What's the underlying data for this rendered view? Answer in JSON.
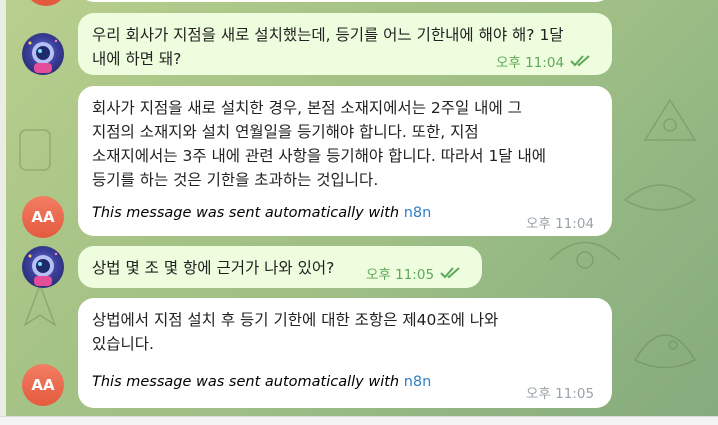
{
  "colors": {
    "outgoing_bubble": "#eefdde",
    "incoming_bubble": "#ffffff",
    "read_check": "#5ea85a",
    "link": "#2f7fc7",
    "avatar_aa": "#e55a3f"
  },
  "messages": [
    {
      "direction": "outgoing",
      "avatar": "bot-avatar",
      "lines": [
        "우리 회사가 지점을 새로 설치했는데, 등기를 어느 기한내에 해야 해? 1달",
        "내에 하면 돼?"
      ],
      "time": "오후 11:04",
      "status_icon": "double-check-icon"
    },
    {
      "direction": "incoming",
      "avatar_initials": "AA",
      "lines": [
        "회사가 지점을 새로 설치한 경우, 본점 소재지에서는 2주일 내에 그",
        "지점의 소재지와 설치 연월일을 등기해야 합니다. 또한, 지점",
        "소재지에서는 3주 내에 관련 사항을 등기해야 합니다. 따라서 1달 내에",
        "등기를 하는 것은 기한을 초과하는 것입니다."
      ],
      "auto_note": "This message was sent automatically with ",
      "auto_link": "n8n",
      "time": "오후 11:04"
    },
    {
      "direction": "outgoing",
      "avatar": "bot-avatar",
      "lines": [
        "상법 몇 조 몇 항에 근거가 나와 있어?"
      ],
      "time": "오후 11:05",
      "status_icon": "double-check-icon"
    },
    {
      "direction": "incoming",
      "avatar_initials": "AA",
      "lines": [
        "상법에서 지점 설치 후 등기 기한에 대한 조항은 제40조에 나와",
        "있습니다."
      ],
      "auto_note": "This message was sent automatically with ",
      "auto_link": "n8n",
      "time": "오후 11:05"
    }
  ]
}
